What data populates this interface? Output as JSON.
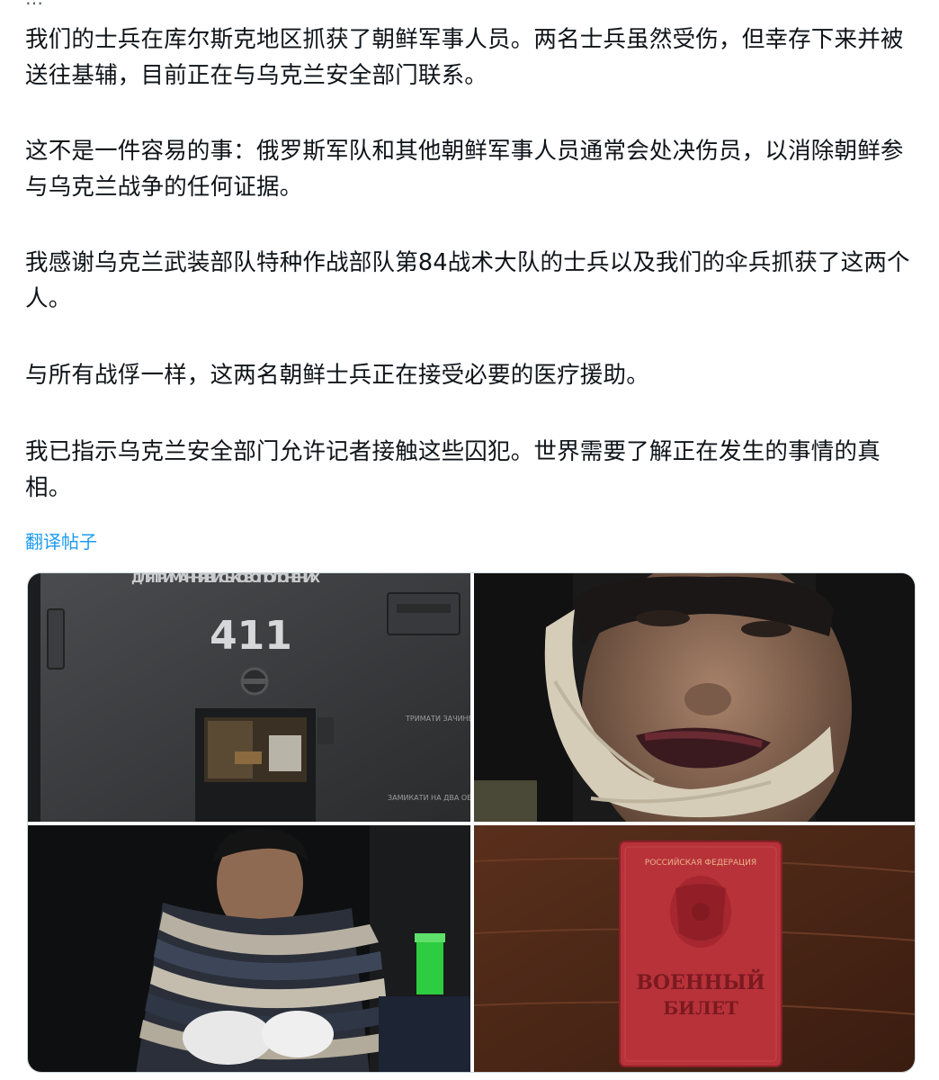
{
  "post": {
    "top_clip_text": "…",
    "paragraphs": [
      "我们的士兵在库尔斯克地区抓获了朝鲜军事人员。两名士兵虽然受伤，但幸存下来并被送往基辅，目前正在与乌克兰安全部门联系。",
      "这不是一件容易的事：俄罗斯军队和其他朝鲜军事人员通常会处决伤员，以消除朝鲜参与乌克兰战争的任何证据。",
      "我感谢乌克兰武装部队特种作战部队第84战术大队的士兵以及我们的伞兵抓获了这两个人。",
      "与所有战俘一样，这两名朝鲜士兵正在接受必要的医疗援助。",
      "我已指示乌克兰安全部门允许记者接触这些囚犯。世界需要了解正在发生的事情的真相。"
    ],
    "translate_label": "翻译帖子"
  },
  "media": {
    "photo1": {
      "door_sign": "ДЛЯ ТРИМАННЯ ВІЙСЬКОВОПОЛОНЕНИХ",
      "door_number": "411",
      "side_label_1": "ТРИМАТИ ЗАЧИНЕНИМИ",
      "side_label_2": "ЗАМИКАТИ НА ДВА ОБЕРТИ"
    },
    "photo2": {},
    "photo3": {},
    "photo4": {
      "id_header": "РОССИЙСКАЯ ФЕДЕРАЦИЯ",
      "id_title_1": "ВОЕННЫЙ",
      "id_title_2": "БИЛЕТ"
    }
  },
  "colors": {
    "link": "#1d9bf0",
    "text": "#0f1419",
    "border": "#cfd9de"
  }
}
